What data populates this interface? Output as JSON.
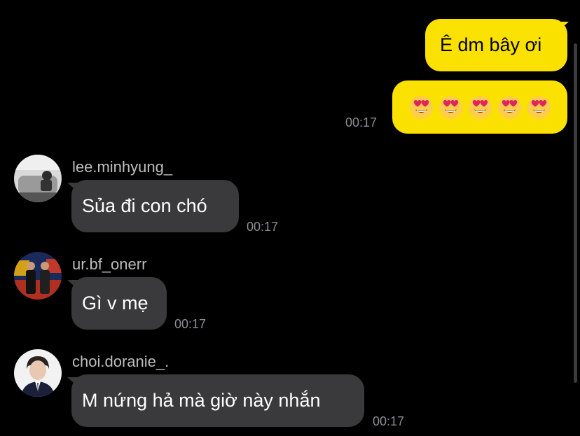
{
  "messages": {
    "out_1": {
      "text": "Ê dm bây ơi"
    },
    "out_2": {
      "emojis": [
        "heart-eyes",
        "heart-eyes",
        "heart-eyes",
        "heart-eyes",
        "heart-eyes"
      ],
      "time": "00:17"
    },
    "in_1": {
      "sender": "lee.minhyung_",
      "text": "Sủa đi con chó",
      "time": "00:17"
    },
    "in_2": {
      "sender": "ur.bf_onerr",
      "text": "Gì v mẹ",
      "time": "00:17"
    },
    "in_3": {
      "sender": "choi.doranie_.",
      "text": "M nứng hả mà giờ này nhắn",
      "time": "00:17"
    }
  },
  "colors": {
    "background": "#000000",
    "outgoing_bubble": "#FAE100",
    "incoming_bubble": "#3A3A3C",
    "timestamp": "#8E8E93",
    "sender_name": "#BDBDBD"
  }
}
